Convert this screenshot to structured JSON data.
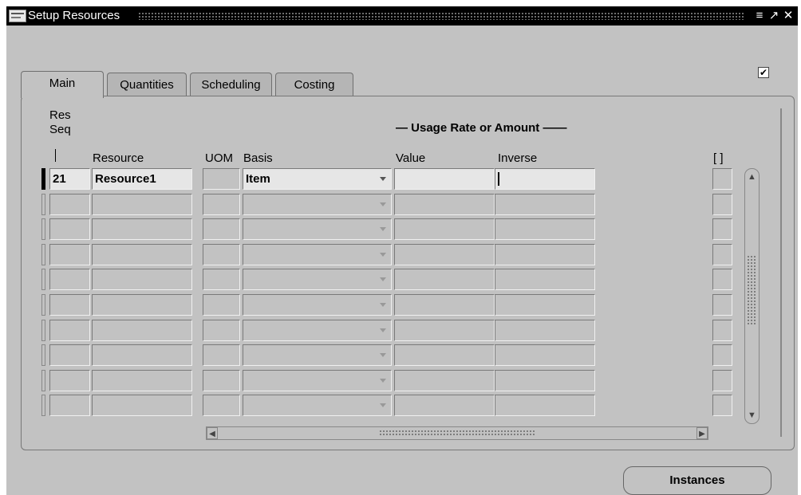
{
  "window": {
    "title": "Setup Resources",
    "controls": [
      "≡",
      "↗",
      "✕"
    ]
  },
  "header_checkbox": {
    "checked": true,
    "mark": "✔"
  },
  "tabs": [
    {
      "label": "Main",
      "active": true
    },
    {
      "label": "Quantities",
      "active": false
    },
    {
      "label": "Scheduling",
      "active": false
    },
    {
      "label": "Costing",
      "active": false
    }
  ],
  "table": {
    "res_seq_label_line1": "Res",
    "res_seq_label_line2": "Seq",
    "group_header": "— Usage Rate or Amount ——",
    "columns": {
      "resource": "Resource",
      "uom": "UOM",
      "basis": "Basis",
      "value": "Value",
      "inverse": "Inverse",
      "flex": "[ ]"
    },
    "rows": [
      {
        "res_seq": "21",
        "resource": "Resource1",
        "uom": "",
        "basis": "Item",
        "value": "",
        "inverse": ""
      },
      {
        "res_seq": "",
        "resource": "",
        "uom": "",
        "basis": "",
        "value": "",
        "inverse": ""
      },
      {
        "res_seq": "",
        "resource": "",
        "uom": "",
        "basis": "",
        "value": "",
        "inverse": ""
      },
      {
        "res_seq": "",
        "resource": "",
        "uom": "",
        "basis": "",
        "value": "",
        "inverse": ""
      },
      {
        "res_seq": "",
        "resource": "",
        "uom": "",
        "basis": "",
        "value": "",
        "inverse": ""
      },
      {
        "res_seq": "",
        "resource": "",
        "uom": "",
        "basis": "",
        "value": "",
        "inverse": ""
      },
      {
        "res_seq": "",
        "resource": "",
        "uom": "",
        "basis": "",
        "value": "",
        "inverse": ""
      },
      {
        "res_seq": "",
        "resource": "",
        "uom": "",
        "basis": "",
        "value": "",
        "inverse": ""
      },
      {
        "res_seq": "",
        "resource": "",
        "uom": "",
        "basis": "",
        "value": "",
        "inverse": ""
      },
      {
        "res_seq": "",
        "resource": "",
        "uom": "",
        "basis": "",
        "value": "",
        "inverse": ""
      }
    ]
  },
  "scroll": {
    "up": "▲",
    "down": "▼",
    "left": "◀",
    "right": "▶"
  },
  "buttons": {
    "instances": "Instances"
  }
}
